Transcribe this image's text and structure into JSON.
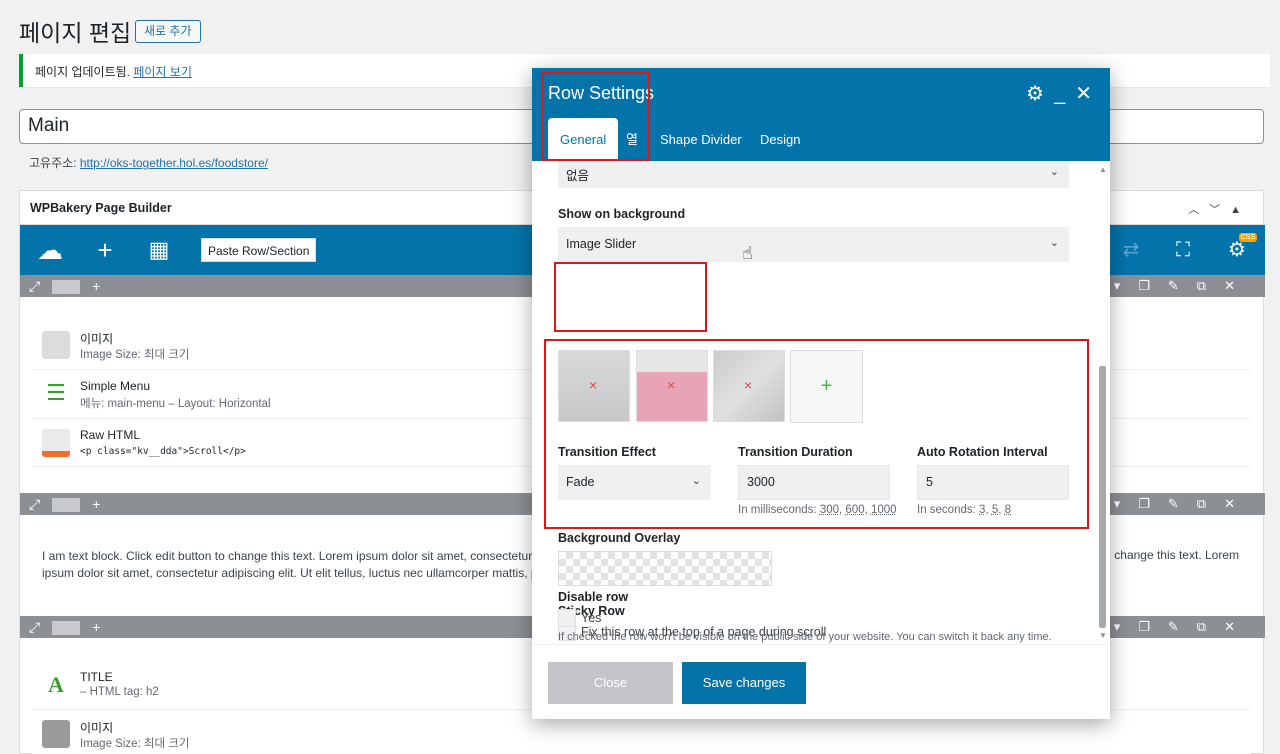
{
  "page": {
    "title": "페이지 편집",
    "add_new": "새로 추가",
    "notice_text": "페이지 업데이트됨.",
    "notice_link": "페이지 보기",
    "title_value": "Main",
    "permalink_label": "고유주소:",
    "permalink_url": "http://oks-together.hol.es/foodstore/"
  },
  "builder": {
    "title": "WPBakery Page Builder",
    "paste_label": "Paste Row/Section",
    "css_badge": "CSS",
    "rows": [
      {
        "elements": [
          {
            "name": "이미지",
            "sub": "Image Size: 최대 크기",
            "icon": "image-icon"
          },
          {
            "name": "Simple Menu",
            "sub": "메뉴: main-menu – Layout: Horizontal",
            "icon": "menu-icon"
          },
          {
            "name": "Raw HTML",
            "sub": "<p class=\"kv__dda\">Scroll</p>",
            "icon": "html-file-icon"
          }
        ]
      },
      {
        "text_left": "I am text block. Click edit button to change this text. Lorem ipsum dolor sit amet, consectetur ad",
        "text_left2": "ipsum dolor sit amet, consectetur adipiscing elit. Ut elit tellus, luctus nec ullamcorper mattis, pulv",
        "text_right": "change this text. Lorem"
      },
      {
        "elements": [
          {
            "name": "TITLE",
            "sub": "– HTML tag: h2",
            "icon": "title-icon"
          },
          {
            "name": "이미지",
            "sub": "Image Size: 최대 크기",
            "icon": "image-icon"
          }
        ]
      }
    ]
  },
  "modal": {
    "title": "Row Settings",
    "tabs": [
      "General",
      "열",
      "Shape Divider",
      "Design"
    ],
    "top_select_value": "없음",
    "show_bg_label": "Show on background",
    "show_bg_value": "Image Slider",
    "transition_effect_label": "Transition Effect",
    "transition_effect_value": "Fade",
    "transition_duration_label": "Transition Duration",
    "transition_duration_value": "3000",
    "transition_duration_hint": "In milliseconds:",
    "transition_duration_options": [
      "300",
      "600",
      "1000"
    ],
    "auto_rotation_label": "Auto Rotation Interval",
    "auto_rotation_value": "5",
    "auto_rotation_hint": "In seconds:",
    "auto_rotation_options": [
      "3",
      "5",
      "8"
    ],
    "bg_overlay_label": "Background Overlay",
    "sticky_label": "Sticky Row",
    "sticky_checkbox_label": "Fix this row at the top of a page during scroll",
    "disable_label": "Disable row",
    "disable_checkbox_label": "Yes",
    "disable_hint": "If checked the row won't be visible on the public side of your website. You can switch it back any time.",
    "close_label": "Close",
    "save_label": "Save changes"
  },
  "colors": {
    "accent": "#0473aa",
    "highlight": "#e0151b",
    "notice": "#00a32a"
  }
}
